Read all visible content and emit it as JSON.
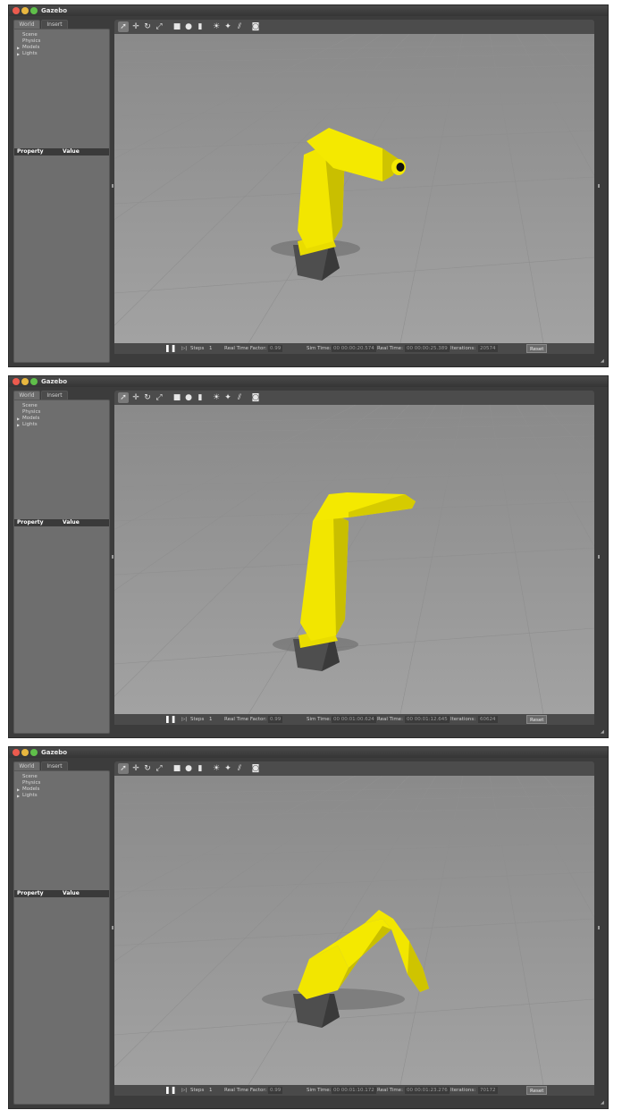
{
  "windows": [
    {
      "app_title": "Gazebo",
      "tabs": [
        "World",
        "Insert"
      ],
      "tree_items": [
        "Scene",
        "Physics",
        "Models",
        "Lights"
      ],
      "property_header": {
        "property": "Property",
        "value": "Value"
      },
      "steps_label": "Steps",
      "steps_value": "1",
      "rtf_label": "Real Time Factor:",
      "rtf_value": "0.99",
      "sim_time_label": "Sim Time:",
      "sim_time_value": "00 00:00:20.574",
      "real_time_label": "Real Time:",
      "real_time_value": "00 00:00:25.389",
      "iterations_label": "Iterations:",
      "iterations_value": "20574",
      "reset_label": "Reset",
      "pose": "upright-bent"
    },
    {
      "app_title": "Gazebo",
      "tabs": [
        "World",
        "Insert"
      ],
      "tree_items": [
        "Scene",
        "Physics",
        "Models",
        "Lights"
      ],
      "property_header": {
        "property": "Property",
        "value": "Value"
      },
      "steps_label": "Steps",
      "steps_value": "1",
      "rtf_label": "Real Time Factor:",
      "rtf_value": "0.99",
      "sim_time_label": "Sim Time:",
      "sim_time_value": "00 00:01:00.624",
      "real_time_label": "Real Time:",
      "real_time_value": "00 00:01:12.645",
      "iterations_label": "Iterations:",
      "iterations_value": "60624",
      "reset_label": "Reset",
      "pose": "upright-extended"
    },
    {
      "app_title": "Gazebo",
      "tabs": [
        "World",
        "Insert"
      ],
      "tree_items": [
        "Scene",
        "Physics",
        "Models",
        "Lights"
      ],
      "property_header": {
        "property": "Property",
        "value": "Value"
      },
      "steps_label": "Steps",
      "steps_value": "1",
      "rtf_label": "Real Time Factor:",
      "rtf_value": "0.99",
      "sim_time_label": "Sim Time:",
      "sim_time_value": "00 00:01:10.172",
      "real_time_label": "Real Time:",
      "real_time_value": "00 00:01:23.276",
      "iterations_label": "Iterations:",
      "iterations_value": "70172",
      "reset_label": "Reset",
      "pose": "folded-down"
    }
  ],
  "toolbar_icons": [
    "select-arrow-icon",
    "translate-icon",
    "rotate-icon",
    "scale-icon",
    "box-shape-icon",
    "sphere-shape-icon",
    "cylinder-shape-icon",
    "point-light-icon",
    "spot-light-icon",
    "directional-light-icon",
    "screenshot-icon"
  ],
  "colors": {
    "robot_yellow": "#f2e600",
    "robot_base": "#5a5a5a",
    "ground": "#a6a6a6",
    "sky": "#8c8c8c",
    "panel": "#6e6e6e"
  }
}
